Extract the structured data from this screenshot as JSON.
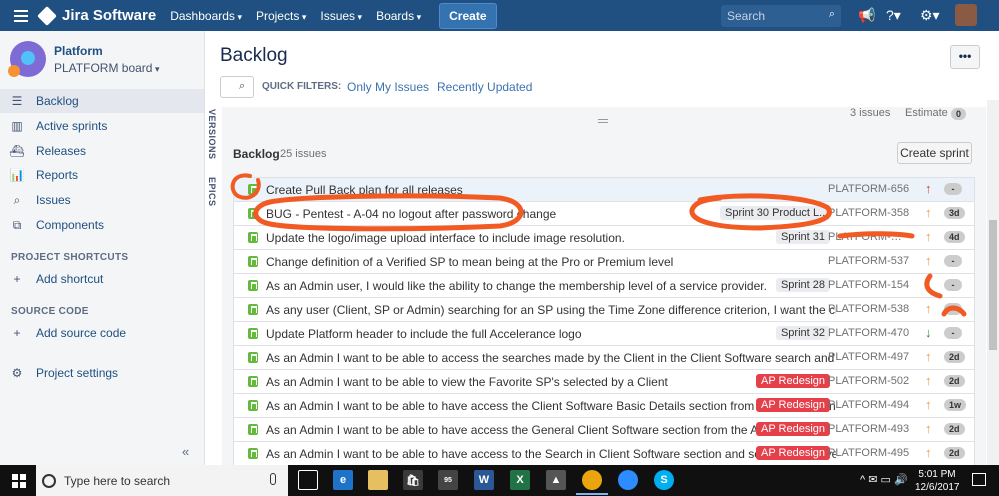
{
  "nav": {
    "product": "Jira Software",
    "items": [
      "Dashboards",
      "Projects",
      "Issues",
      "Boards"
    ],
    "create_label": "Create",
    "search_placeholder": "Search"
  },
  "sidebar": {
    "project_name": "Platform",
    "board_name": "PLATFORM board",
    "items": [
      {
        "label": "Backlog",
        "icon": "backlog-icon"
      },
      {
        "label": "Active sprints",
        "icon": "board-icon"
      },
      {
        "label": "Releases",
        "icon": "ship-icon"
      },
      {
        "label": "Reports",
        "icon": "chart-icon"
      },
      {
        "label": "Issues",
        "icon": "issues-icon"
      },
      {
        "label": "Components",
        "icon": "puzzle-icon"
      }
    ],
    "shortcuts_heading": "PROJECT SHORTCUTS",
    "add_shortcut": "Add shortcut",
    "source_heading": "SOURCE CODE",
    "add_source": "Add source code",
    "settings": "Project settings",
    "collapse_glyph": "«"
  },
  "main": {
    "title": "Backlog",
    "more_glyph": "•••",
    "quick_filters_label": "QUICK FILTERS:",
    "quick_filters": [
      "Only My Issues",
      "Recently Updated"
    ],
    "vtabs": [
      "VERSIONS",
      "EPICS"
    ],
    "sprint_issues": "3 issues",
    "estimate_label": "Estimate",
    "estimate_value": "0",
    "backlog_title": "Backlog",
    "backlog_count": "25 issues",
    "create_sprint": "Create sprint"
  },
  "issues": [
    {
      "summary": "Create Pull Back plan for all releases",
      "label": "",
      "label_style": "",
      "key": "PLATFORM-656",
      "priority": "high",
      "estimate": "-",
      "selected": true
    },
    {
      "summary": "BUG - Pentest - A-04 no logout after password change",
      "label": "Sprint 30 Product L...",
      "label_style": "grey",
      "key": "PLATFORM-358",
      "priority": "medium",
      "estimate": "3d",
      "selected": false
    },
    {
      "summary": "Update the logo/image upload interface to include image resolution.",
      "label": "Sprint 31",
      "label_style": "grey",
      "key": "PLATFORM-…",
      "priority": "medium",
      "estimate": "4d",
      "selected": false
    },
    {
      "summary": "Change definition of a Verified SP to mean being at the Pro or Premium level",
      "label": "",
      "label_style": "",
      "key": "PLATFORM-537",
      "priority": "medium",
      "estimate": "-",
      "selected": false
    },
    {
      "summary": "As an Admin user, I would like the ability to change the membership level of a service provider.",
      "label": "Sprint 28",
      "label_style": "grey",
      "key": "PLATFORM-154",
      "priority": "medium",
      "estimate": "-",
      "selected": false
    },
    {
      "summary": "As any user (Client, SP or Admin) searching for an SP using the Time Zone difference criterion, I want the criterion to contribute",
      "label": "",
      "label_style": "",
      "key": "PLATFORM-538",
      "priority": "medium",
      "estimate": "-",
      "selected": false
    },
    {
      "summary": "Update Platform header to include the full Accelerance logo",
      "label": "Sprint 32",
      "label_style": "grey",
      "key": "PLATFORM-470",
      "priority": "low",
      "estimate": "-",
      "selected": false
    },
    {
      "summary": "As an Admin I want to be able to access the searches made by the Client in the Client Software search and see the result that",
      "label": "",
      "label_style": "",
      "key": "PLATFORM-497",
      "priority": "medium",
      "estimate": "2d",
      "selected": false
    },
    {
      "summary": "As an Admin I want to be able to view the Favorite SP's selected by a Client",
      "label": "AP Redesign",
      "label_style": "red",
      "key": "PLATFORM-502",
      "priority": "medium",
      "estimate": "2d",
      "selected": false
    },
    {
      "summary": "As an Admin I want to be able to have access the Client Software Basic Details section from the Admin Panel",
      "label": "AP Redesign",
      "label_style": "red",
      "key": "PLATFORM-494",
      "priority": "medium",
      "estimate": "1w",
      "selected": false
    },
    {
      "summary": "As an Admin I want to be able to have access the General Client Software section from the Admin Panel",
      "label": "AP Redesign",
      "label_style": "red",
      "key": "PLATFORM-493",
      "priority": "medium",
      "estimate": "2d",
      "selected": false
    },
    {
      "summary": "As an Admin I want to be able to have access to the Search in Client Software section and see the last saved",
      "label": "AP Redesign",
      "label_style": "red",
      "key": "PLATFORM-495",
      "priority": "medium",
      "estimate": "2d",
      "selected": false
    }
  ],
  "priority_glyphs": {
    "high": "↑",
    "medium": "↑",
    "low": "↓"
  },
  "priority_colors": {
    "high": "#d04437",
    "medium": "#f79232",
    "low": "#2a8735"
  },
  "annotation_color": "#f15a22",
  "taskbar": {
    "search_placeholder": "Type here to search",
    "time": "5:01 PM",
    "date": "12/6/2017",
    "badge": "95"
  }
}
